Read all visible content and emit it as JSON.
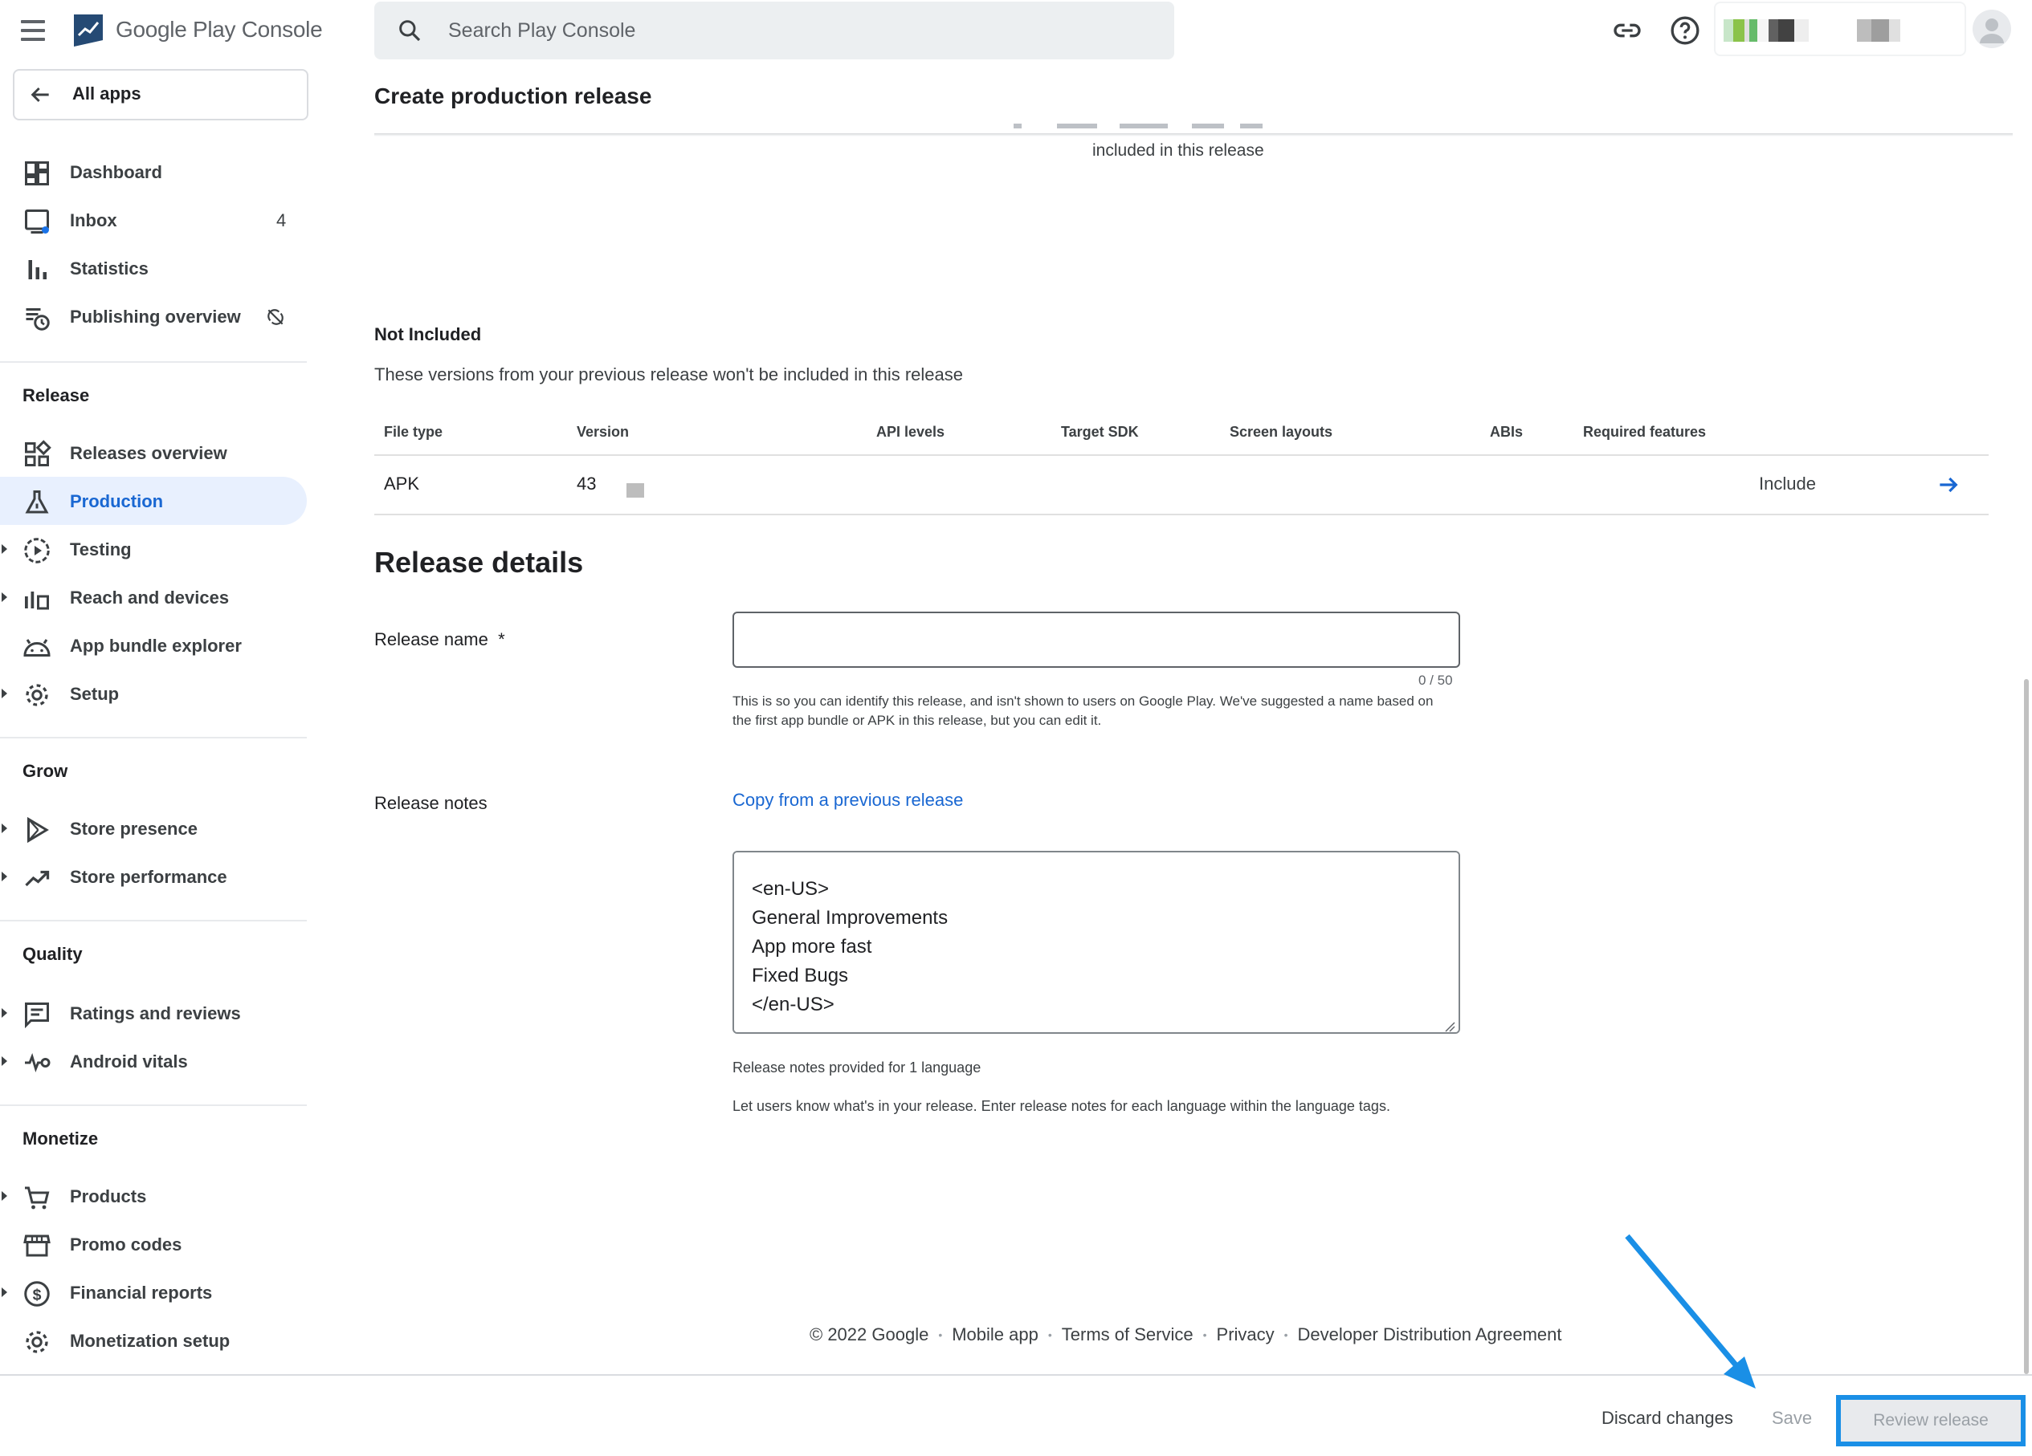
{
  "header": {
    "logo_text": "Google Play Console",
    "search_placeholder": "Search Play Console"
  },
  "sidebar": {
    "all_apps": "All apps",
    "top_items": [
      {
        "label": "Dashboard",
        "icon": "dashboard-icon"
      },
      {
        "label": "Inbox",
        "icon": "inbox-icon",
        "badge": "4"
      },
      {
        "label": "Statistics",
        "icon": "bar-chart-icon"
      },
      {
        "label": "Publishing overview",
        "icon": "publishing-history-icon"
      }
    ],
    "sections": {
      "release": "Release",
      "grow": "Grow",
      "quality": "Quality",
      "monetize": "Monetize"
    },
    "release_items": [
      {
        "label": "Releases overview",
        "icon": "releases-grid-icon"
      },
      {
        "label": "Production",
        "icon": "flask-icon",
        "active": true
      },
      {
        "label": "Testing",
        "icon": "play-circle-icon"
      },
      {
        "label": "Reach and devices",
        "icon": "devices-chart-icon"
      },
      {
        "label": "App bundle explorer",
        "icon": "android-icon"
      },
      {
        "label": "Setup",
        "icon": "gear-icon"
      }
    ],
    "grow_items": [
      {
        "label": "Store presence",
        "icon": "play-store-icon"
      },
      {
        "label": "Store performance",
        "icon": "trending-up-icon"
      }
    ],
    "quality_items": [
      {
        "label": "Ratings and reviews",
        "icon": "reviews-icon"
      },
      {
        "label": "Android vitals",
        "icon": "vitals-icon"
      }
    ],
    "monetize_items": [
      {
        "label": "Products",
        "icon": "cart-icon"
      },
      {
        "label": "Promo codes",
        "icon": "storefront-icon"
      },
      {
        "label": "Financial reports",
        "icon": "dollar-icon"
      },
      {
        "label": "Monetization setup",
        "icon": "gear-icon"
      }
    ]
  },
  "page": {
    "title": "Create production release",
    "included_note": "included in this release",
    "not_included_title": "Not Included",
    "not_included_desc": "These versions from your previous release won't be included in this release",
    "table": {
      "headers": [
        "File type",
        "Version",
        "API levels",
        "Target SDK",
        "Screen layouts",
        "ABIs",
        "Required features"
      ],
      "row": {
        "file_type": "APK",
        "version": "43",
        "action": "Include"
      }
    },
    "release_details": "Release details",
    "release_name_label": "Release name",
    "required_mark": "*",
    "release_name_value": "",
    "char_count": "0 / 50",
    "release_name_help": "This is so you can identify this release, and isn't shown to users on Google Play. We've suggested a name based on the first app bundle or APK in this release, but you can edit it.",
    "release_notes_label": "Release notes",
    "copy_link": "Copy from a previous release",
    "release_notes_value": "<en-US>\nGeneral Improvements\nApp more fast\nFixed Bugs\n</en-US>",
    "notes_count": "Release notes provided for 1 language",
    "notes_help": "Let users know what's in your release. Enter release notes for each language within the language tags."
  },
  "footer": {
    "copyright": "© 2022 Google",
    "links": [
      "Mobile app",
      "Terms of Service",
      "Privacy",
      "Developer Distribution Agreement"
    ]
  },
  "actions": {
    "discard": "Discard changes",
    "save": "Save",
    "review": "Review release"
  },
  "colors": {
    "accent": "#1967d2",
    "active_bg": "#e8f0fe",
    "annotation": "#1a8fe6"
  }
}
